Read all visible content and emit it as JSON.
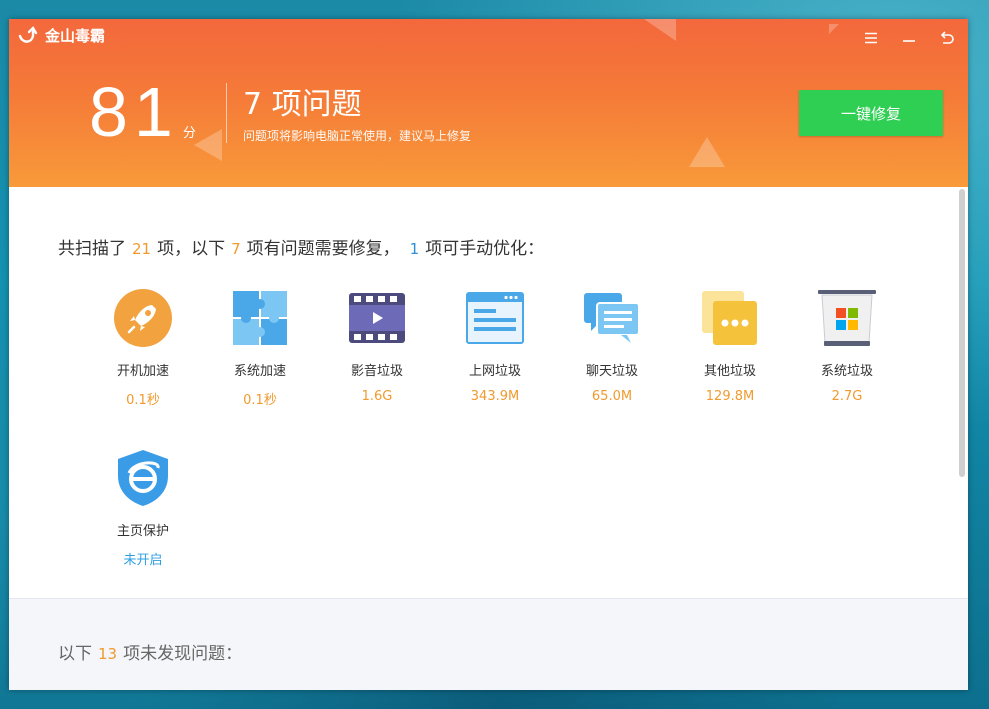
{
  "app": {
    "name": "金山毒霸"
  },
  "header": {
    "score": "81",
    "score_unit": "分",
    "issue_title": "7 项问题",
    "issue_subtitle": "问题项将影响电脑正常使用，建议马上修复",
    "fix_button": "一键修复"
  },
  "summary": {
    "prefix": "共扫描了",
    "total": "21",
    "mid1": "项，以下",
    "issues": "7",
    "mid2": "项有问题需要修复，",
    "manual": "1",
    "suffix": "项可手动优化："
  },
  "items": [
    {
      "label": "开机加速",
      "value": "0.1秒",
      "icon": "rocket-icon"
    },
    {
      "label": "系统加速",
      "value": "0.1秒",
      "icon": "puzzle-icon"
    },
    {
      "label": "影音垃圾",
      "value": "1.6G",
      "icon": "film-icon"
    },
    {
      "label": "上网垃圾",
      "value": "343.9M",
      "icon": "browser-icon"
    },
    {
      "label": "聊天垃圾",
      "value": "65.0M",
      "icon": "chat-icon"
    },
    {
      "label": "其他垃圾",
      "value": "129.8M",
      "icon": "folder-dots-icon"
    },
    {
      "label": "系统垃圾",
      "value": "2.7G",
      "icon": "windows-trash-icon"
    },
    {
      "label": "主页保护",
      "value": "未开启",
      "icon": "ie-shield-icon"
    }
  ],
  "footer": {
    "prefix": "以下",
    "count": "13",
    "suffix": "项未发现问题："
  },
  "colors": {
    "header_top": "#f3683c",
    "header_bottom": "#f89a3a",
    "fix_button": "#2fcf54",
    "highlight_orange": "#f29a2e",
    "highlight_blue": "#2e8fd8"
  }
}
